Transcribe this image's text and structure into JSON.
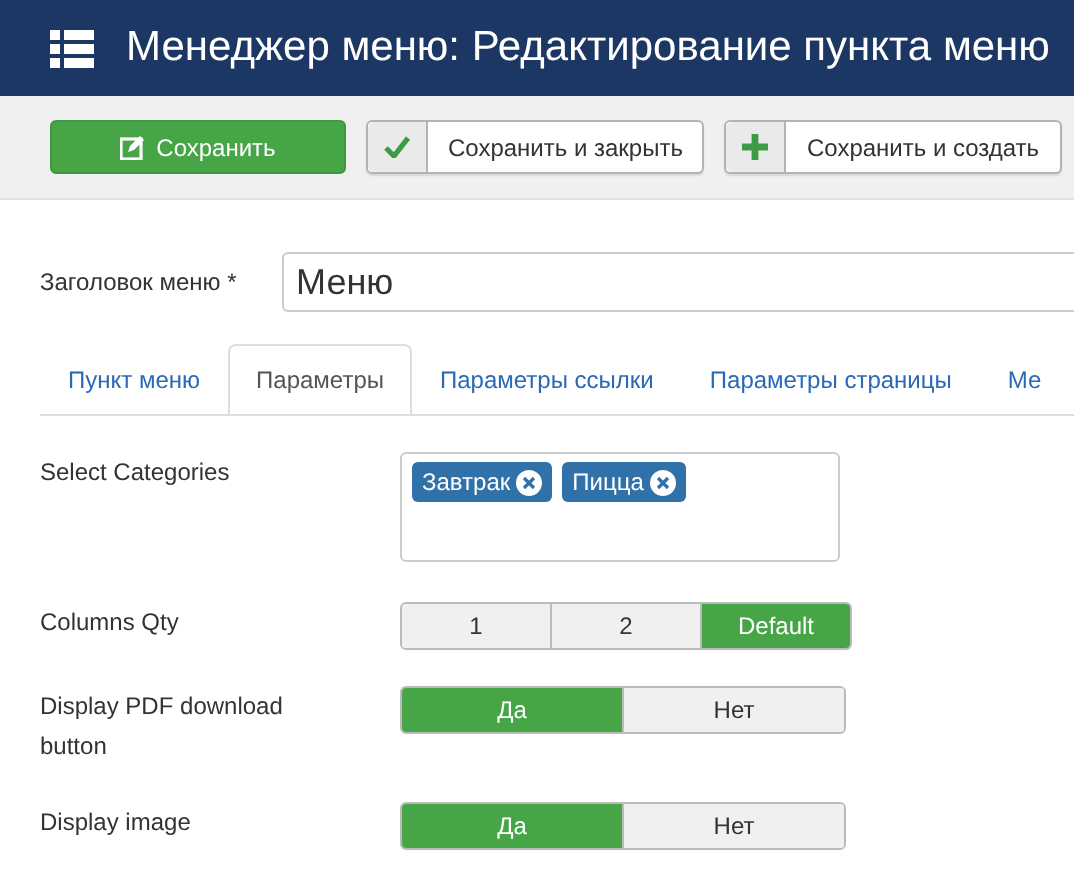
{
  "header": {
    "title": "Менеджер меню: Редактирование пункта меню"
  },
  "toolbar": [
    {
      "kind": "primary",
      "label": "Сохранить"
    },
    {
      "kind": "check",
      "label": "Сохранить и закрыть"
    },
    {
      "kind": "plus",
      "label": "Сохранить и создать"
    }
  ],
  "title_field": {
    "label": "Заголовок меню *",
    "value": "Меню"
  },
  "tabs": [
    {
      "label": "Пункт меню",
      "selected": false
    },
    {
      "label": "Параметры",
      "selected": true
    },
    {
      "label": "Параметры ссылки",
      "selected": false
    },
    {
      "label": "Параметры страницы",
      "selected": false
    },
    {
      "label": "Ме",
      "selected": false
    }
  ],
  "fields": [
    {
      "kind": "tags",
      "label": "Select Categories",
      "tags": [
        "Завтрак",
        "Пицца"
      ]
    },
    {
      "kind": "segmented",
      "label": "Columns Qty",
      "options": [
        {
          "label": "1",
          "selected": false
        },
        {
          "label": "2",
          "selected": false
        },
        {
          "label": "Default",
          "selected": true
        }
      ]
    },
    {
      "kind": "segmented",
      "label": "Display PDF download button",
      "options": [
        {
          "label": "Да",
          "selected": true
        },
        {
          "label": "Нет",
          "selected": false
        }
      ]
    },
    {
      "kind": "segmented",
      "label": "Display image",
      "options": [
        {
          "label": "Да",
          "selected": true
        },
        {
          "label": "Нет",
          "selected": false
        }
      ]
    }
  ]
}
